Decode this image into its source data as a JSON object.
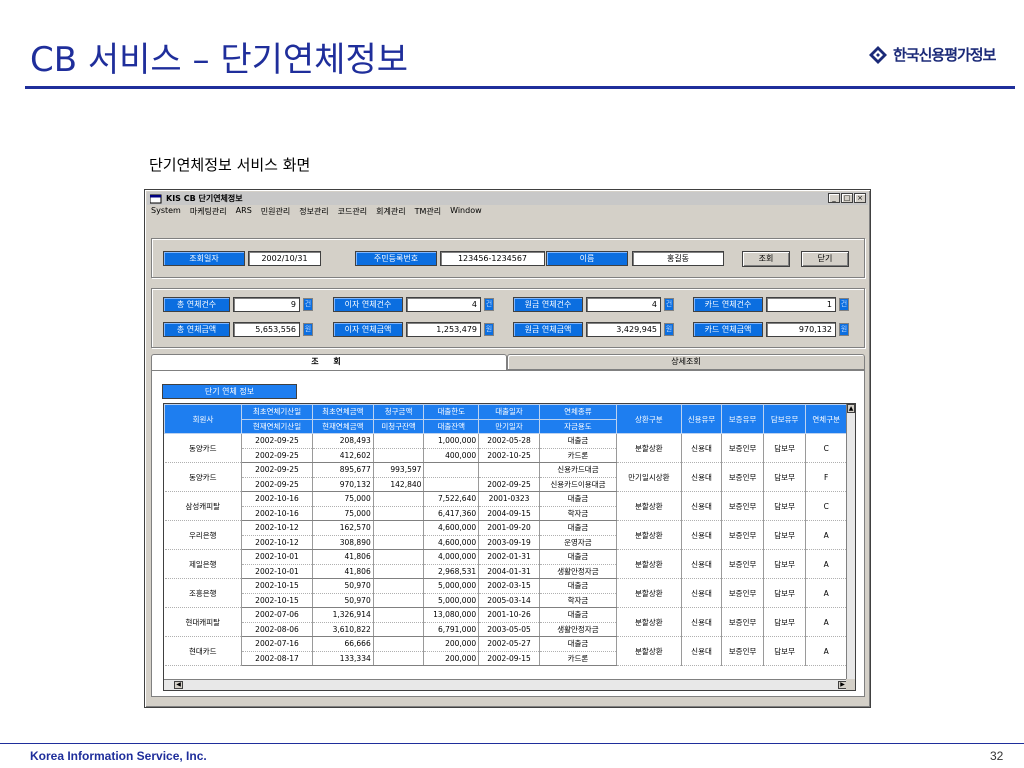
{
  "slide": {
    "title": "CB 서비스 – 단기연체정보",
    "logo_text": "한국신용평가정보",
    "caption": "단기연체정보 서비스 화면",
    "footer": "Korea Information Service, Inc.",
    "page_number": "32"
  },
  "window": {
    "title": "KIS   CB 단기연체정보",
    "controls": {
      "minimize": "_",
      "restore": "□",
      "close": "×"
    },
    "menu": [
      "System",
      "마케팅관리",
      "ARS",
      "민원관리",
      "정보관리",
      "코드관리",
      "회계관리",
      "TM관리",
      "Window"
    ]
  },
  "search": {
    "date_label": "조회일자",
    "date_value": "2002/10/31",
    "rrn_label": "주민등록번호",
    "rrn_value": "123456-1234567",
    "name_label": "이름",
    "name_value": "홍길동",
    "query_button": "조회",
    "close_button": "닫기"
  },
  "summary": {
    "toggle": "건",
    "toggle2": "원",
    "counts": [
      {
        "label": "총 연체건수",
        "value": "9"
      },
      {
        "label": "이자 연체건수",
        "value": "4"
      },
      {
        "label": "원금 연체건수",
        "value": "4"
      },
      {
        "label": "카드 연체건수",
        "value": "1"
      }
    ],
    "amounts": [
      {
        "label": "총 연체금액",
        "value": "5,653,556"
      },
      {
        "label": "이자 연체금액",
        "value": "1,253,479"
      },
      {
        "label": "원금 연체금액",
        "value": "3,429,945"
      },
      {
        "label": "카드 연체금액",
        "value": "970,132"
      }
    ]
  },
  "tabs": {
    "active": "조 회",
    "inactive": "상세조회"
  },
  "section_label": "단기 연체 정보",
  "grid": {
    "headers_top": [
      "회원사",
      "최초연체기산일",
      "최초연체금액",
      "청구금액",
      "대출한도",
      "대출일자",
      "연체종류",
      "상환구분",
      "신용유무",
      "보증유무",
      "담보유무",
      "연체구분"
    ],
    "headers_bottom": [
      "현재연체기산일",
      "현재연체금액",
      "미청구잔액",
      "대출잔액",
      "만기일자",
      "자금용도"
    ],
    "groups": [
      {
        "member": "동양카드",
        "repay": "분할상환",
        "credit": "신용대",
        "guarantee": "보증인무",
        "collateral": "담보무",
        "type": "C",
        "rows": [
          [
            "2002-09-25",
            "208,493",
            "",
            "1,000,000",
            "2002-05-28",
            "대출금"
          ],
          [
            "2002-09-25",
            "412,602",
            "",
            "400,000",
            "2002-10-25",
            "카드론"
          ]
        ]
      },
      {
        "member": "동양카드",
        "repay": "만기일시상환",
        "credit": "신용대",
        "guarantee": "보증인무",
        "collateral": "담보무",
        "type": "F",
        "rows": [
          [
            "2002-09-25",
            "895,677",
            "993,597",
            "",
            "",
            "신용카드대금"
          ],
          [
            "2002-09-25",
            "970,132",
            "142,840",
            "",
            "2002-09-25",
            "신용카드이용대금"
          ]
        ]
      },
      {
        "member": "삼성캐피탈",
        "repay": "분할상환",
        "credit": "신용대",
        "guarantee": "보증인무",
        "collateral": "담보무",
        "type": "C",
        "rows": [
          [
            "2002-10-16",
            "75,000",
            "",
            "7,522,640",
            "2001-0323",
            "대출금"
          ],
          [
            "2002-10-16",
            "75,000",
            "",
            "6,417,360",
            "2004-09-15",
            "학자금"
          ]
        ]
      },
      {
        "member": "우리은행",
        "repay": "분할상환",
        "credit": "신용대",
        "guarantee": "보증인무",
        "collateral": "담보무",
        "type": "A",
        "rows": [
          [
            "2002-10-12",
            "162,570",
            "",
            "4,600,000",
            "2001-09-20",
            "대출금"
          ],
          [
            "2002-10-12",
            "308,890",
            "",
            "4,600,000",
            "2003-09-19",
            "운영자금"
          ]
        ]
      },
      {
        "member": "제일은행",
        "repay": "분할상환",
        "credit": "신용대",
        "guarantee": "보증인무",
        "collateral": "담보무",
        "type": "A",
        "rows": [
          [
            "2002-10-01",
            "41,806",
            "",
            "4,000,000",
            "2002-01-31",
            "대출금"
          ],
          [
            "2002-10-01",
            "41,806",
            "",
            "2,968,531",
            "2004-01-31",
            "생활안정자금"
          ]
        ]
      },
      {
        "member": "조흥은행",
        "repay": "분할상환",
        "credit": "신용대",
        "guarantee": "보증인무",
        "collateral": "담보무",
        "type": "A",
        "rows": [
          [
            "2002-10-15",
            "50,970",
            "",
            "5,000,000",
            "2002-03-15",
            "대출금"
          ],
          [
            "2002-10-15",
            "50,970",
            "",
            "5,000,000",
            "2005-03-14",
            "학자금"
          ]
        ]
      },
      {
        "member": "현대캐피탈",
        "repay": "분할상환",
        "credit": "신용대",
        "guarantee": "보증인무",
        "collateral": "담보무",
        "type": "A",
        "rows": [
          [
            "2002-07-06",
            "1,326,914",
            "",
            "13,080,000",
            "2001-10-26",
            "대출금"
          ],
          [
            "2002-08-06",
            "3,610,822",
            "",
            "6,791,000",
            "2003-05-05",
            "생활안정자금"
          ]
        ]
      },
      {
        "member": "현대카드",
        "repay": "분할상환",
        "credit": "신용대",
        "guarantee": "보증인무",
        "collateral": "담보무",
        "type": "A",
        "rows": [
          [
            "2002-07-16",
            "66,666",
            "",
            "200,000",
            "2002-05-27",
            "대출금"
          ],
          [
            "2002-08-17",
            "133,334",
            "",
            "200,000",
            "2002-09-15",
            "카드론"
          ]
        ]
      }
    ]
  },
  "icons": {
    "logo": "diamond-logo-icon",
    "app": "app-window-icon"
  },
  "colors": {
    "title": "#1f2e9b",
    "label_bg": "#0b6ee0",
    "header_bg": "#1e7ef0",
    "window_bg": "#d4d0c8"
  }
}
